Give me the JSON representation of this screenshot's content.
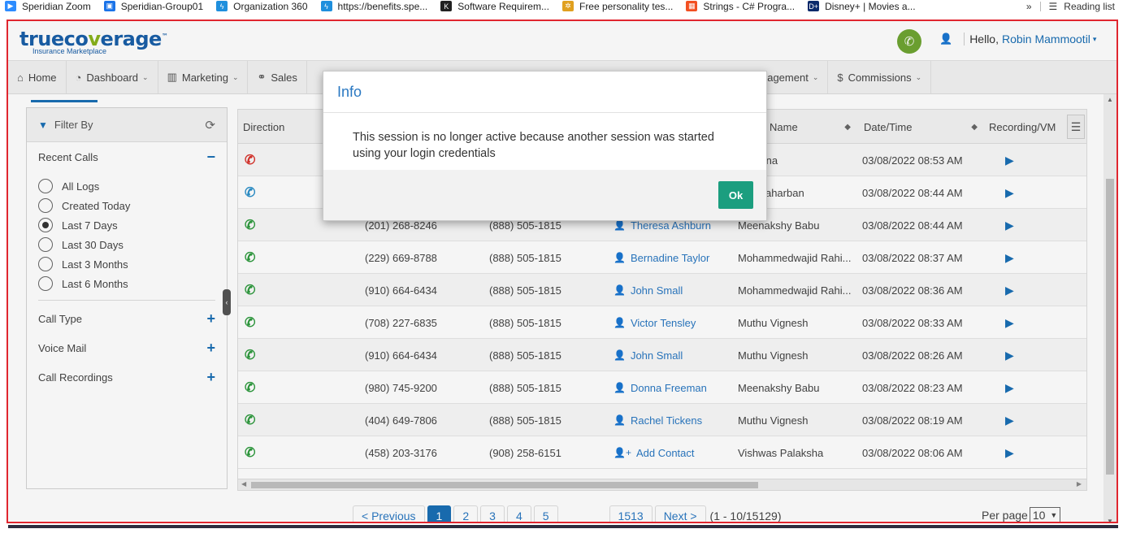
{
  "bookmarks": [
    {
      "label": "Speridian Zoom",
      "icon": "zoom-icon",
      "color": "#2d8cff"
    },
    {
      "label": "Speridian-Group01",
      "icon": "contact-card-icon",
      "color": "#1a73e8"
    },
    {
      "label": "Organization 360",
      "icon": "salesforce-bolt-icon",
      "color": "#1f8fdd"
    },
    {
      "label": "https://benefits.spe...",
      "icon": "salesforce-bolt-icon",
      "color": "#1f8fdd"
    },
    {
      "label": "Software Requirem...",
      "icon": "k-logo-icon",
      "color": "#222222"
    },
    {
      "label": "Free personality tes...",
      "icon": "dots-logo-icon",
      "color": "#e0a020"
    },
    {
      "label": "Strings - C# Progra...",
      "icon": "windows-logo-icon",
      "color": "#f25022"
    },
    {
      "label": "Disney+ | Movies a...",
      "icon": "disney-logo-icon",
      "color": "#0a2a6b"
    }
  ],
  "bookmarks_more": "»",
  "reading_list": "Reading list",
  "header": {
    "logo_main_a": "trueco",
    "logo_main_b": "v",
    "logo_main_c": "erage",
    "logo_tm": "™",
    "logo_sub": "Insurance Marketplace",
    "greeting": "Hello,",
    "user_name": "Robin Mammootil"
  },
  "nav": [
    {
      "label": "Home",
      "icon": "home-icon",
      "glyph": "⌂",
      "caret": false
    },
    {
      "label": "Dashboard",
      "icon": "dashboard-icon",
      "glyph": "◔",
      "caret": true
    },
    {
      "label": "Marketing",
      "icon": "bar-chart-icon",
      "glyph": "▥",
      "caret": true
    },
    {
      "label": "Sales",
      "icon": "handshake-icon",
      "glyph": "⚭",
      "caret": false
    },
    {
      "label": "Management",
      "icon": "",
      "glyph": "",
      "caret": true
    },
    {
      "label": "Commissions",
      "icon": "dollar-icon",
      "glyph": "$",
      "caret": true
    }
  ],
  "filter": {
    "title": "Filter By",
    "recent_calls": "Recent Calls",
    "options": [
      {
        "label": "All Logs",
        "checked": false
      },
      {
        "label": "Created Today",
        "checked": false
      },
      {
        "label": "Last 7 Days",
        "checked": true
      },
      {
        "label": "Last 30 Days",
        "checked": false
      },
      {
        "label": "Last 3 Months",
        "checked": false
      },
      {
        "label": "Last 6 Months",
        "checked": false
      }
    ],
    "call_type": "Call Type",
    "voice_mail": "Voice Mail",
    "call_recordings": "Call Recordings"
  },
  "table": {
    "headers": {
      "direction": "Direction",
      "name": "Name",
      "datetime": "Date/Time",
      "recording": "Recording/VM"
    },
    "rows": [
      {
        "dir": "missed",
        "from": "",
        "to": "",
        "contact": "",
        "agent": "Orellana",
        "date": "03/08/2022 08:53 AM"
      },
      {
        "dir": "outgoing",
        "from": "",
        "to": "",
        "contact": "",
        "agent": "na Shaharban",
        "date": "03/08/2022 08:44 AM"
      },
      {
        "dir": "incoming",
        "from": "(201) 268-8246",
        "to": "(888) 505-1815",
        "contact": "Theresa Ashburn",
        "agent": "Meenakshy Babu",
        "date": "03/08/2022 08:44 AM"
      },
      {
        "dir": "incoming",
        "from": "(229) 669-8788",
        "to": "(888) 505-1815",
        "contact": "Bernadine Taylor",
        "agent": "Mohammedwajid Rahi...",
        "date": "03/08/2022 08:37 AM"
      },
      {
        "dir": "incoming",
        "from": "(910) 664-6434",
        "to": "(888) 505-1815",
        "contact": "John Small",
        "agent": "Mohammedwajid Rahi...",
        "date": "03/08/2022 08:36 AM"
      },
      {
        "dir": "incoming",
        "from": "(708) 227-6835",
        "to": "(888) 505-1815",
        "contact": "Victor Tensley",
        "agent": "Muthu Vignesh",
        "date": "03/08/2022 08:33 AM"
      },
      {
        "dir": "incoming",
        "from": "(910) 664-6434",
        "to": "(888) 505-1815",
        "contact": "John Small",
        "agent": "Muthu Vignesh",
        "date": "03/08/2022 08:26 AM"
      },
      {
        "dir": "incoming",
        "from": "(980) 745-9200",
        "to": "(888) 505-1815",
        "contact": "Donna Freeman",
        "agent": "Meenakshy Babu",
        "date": "03/08/2022 08:23 AM"
      },
      {
        "dir": "incoming",
        "from": "(404) 649-7806",
        "to": "(888) 505-1815",
        "contact": "Rachel Tickens",
        "agent": "Muthu Vignesh",
        "date": "03/08/2022 08:19 AM"
      },
      {
        "dir": "incoming",
        "from": "(458) 203-3176",
        "to": "(908) 258-6151",
        "contact": "Add Contact",
        "contact_is_add": true,
        "agent": "Vishwas Palaksha",
        "date": "03/08/2022 08:06 AM"
      }
    ]
  },
  "colors": {
    "missed": "#d9322b",
    "outgoing": "#2a8fc9",
    "incoming": "#2c9a3c",
    "accent": "#1a6fb5",
    "ok_button": "#1b9e7f"
  },
  "pager": {
    "prev": "< Previous",
    "pages": [
      "1",
      "2",
      "3",
      "4",
      "5"
    ],
    "last": "1513",
    "next": "Next >",
    "info": "(1 - 10/15129)",
    "per_page_label": "Per page",
    "per_page_value": "10"
  },
  "modal": {
    "title": "Info",
    "message": "This session is no longer active because another session was started using your login credentials",
    "ok_label": "Ok"
  }
}
